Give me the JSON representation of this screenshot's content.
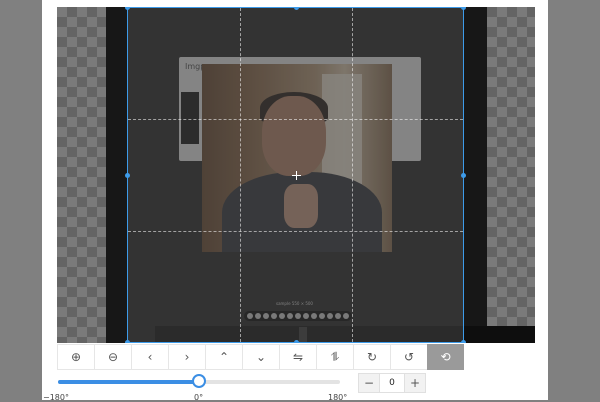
{
  "canvas": {
    "inner_card_title": "Imgpo",
    "image_caption": "sample 550 × 500"
  },
  "toolbar": [
    {
      "name": "zoom-in-icon",
      "glyph": "⊕"
    },
    {
      "name": "zoom-out-icon",
      "glyph": "⊖"
    },
    {
      "name": "arrow-left-icon",
      "glyph": "‹"
    },
    {
      "name": "arrow-right-icon",
      "glyph": "›"
    },
    {
      "name": "arrow-up-icon",
      "glyph": "⌃"
    },
    {
      "name": "arrow-down-icon",
      "glyph": "⌄"
    },
    {
      "name": "flip-horizontal-icon",
      "glyph": "⇋"
    },
    {
      "name": "flip-vertical-icon",
      "glyph": "⥮"
    },
    {
      "name": "rotate-right-icon",
      "glyph": "↻"
    },
    {
      "name": "rotate-left-icon",
      "glyph": "↺"
    },
    {
      "name": "reset-icon",
      "glyph": "⟲"
    }
  ],
  "rotate": {
    "min_label": "−180°",
    "mid_label": "0°",
    "max_label": "180°",
    "min": -180,
    "max": 180,
    "value": 0,
    "stepper_minus": "−",
    "stepper_plus": "+",
    "stepper_value": "0"
  },
  "colors": {
    "accent": "#3b8ee4",
    "crop_border": "#3d9be9"
  }
}
